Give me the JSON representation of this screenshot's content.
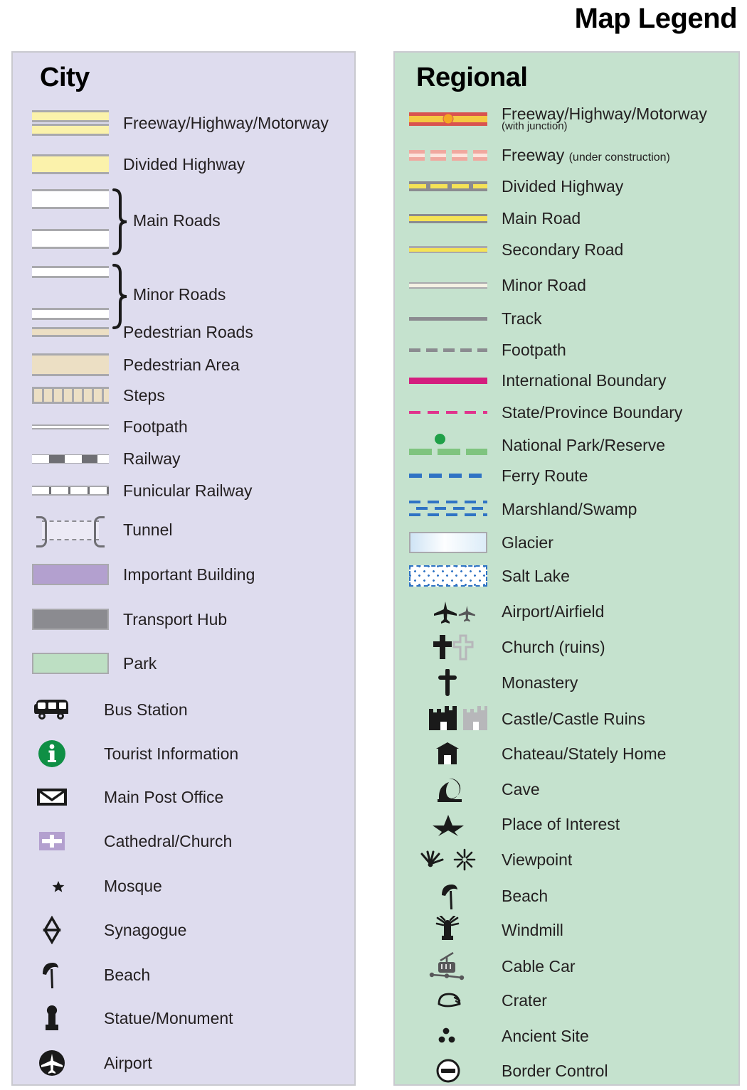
{
  "title": "Map Legend",
  "city": {
    "heading": "City",
    "bg_color": "#dedcee",
    "items": [
      {
        "symbol": "freeway-double-band",
        "label": "Freeway/Highway/Motorway"
      },
      {
        "symbol": "divided-highway-band",
        "label": "Divided Highway"
      },
      {
        "symbol": "main-roads-braced-pair",
        "label": "Main Roads"
      },
      {
        "symbol": "minor-roads-braced-pair",
        "label": "Minor Roads"
      },
      {
        "symbol": "pedestrian-road-band",
        "label": "Pedestrian Roads"
      },
      {
        "symbol": "pedestrian-area-block",
        "label": "Pedestrian Area"
      },
      {
        "symbol": "steps-hatched-band",
        "label": "Steps"
      },
      {
        "symbol": "footpath-thin-line",
        "label": "Footpath"
      },
      {
        "symbol": "railway-dashed-band",
        "label": "Railway"
      },
      {
        "symbol": "funicular-ticked-line",
        "label": "Funicular Railway"
      },
      {
        "symbol": "tunnel-bracketed-dashes",
        "label": "Tunnel"
      },
      {
        "symbol": "important-building-swatch",
        "label": "Important Building"
      },
      {
        "symbol": "transport-hub-swatch",
        "label": "Transport Hub"
      },
      {
        "symbol": "park-swatch",
        "label": "Park"
      },
      {
        "symbol": "bus-icon",
        "label": "Bus Station"
      },
      {
        "symbol": "information-circle-icon",
        "label": "Tourist Information"
      },
      {
        "symbol": "envelope-icon",
        "label": "Main Post Office"
      },
      {
        "symbol": "church-cross-block-icon",
        "label": "Cathedral/Church"
      },
      {
        "symbol": "crescent-star-icon",
        "label": "Mosque"
      },
      {
        "symbol": "star-of-david-icon",
        "label": "Synagogue"
      },
      {
        "symbol": "beach-umbrella-icon",
        "label": "Beach"
      },
      {
        "symbol": "statue-monument-icon",
        "label": "Statue/Monument"
      },
      {
        "symbol": "airport-circle-icon",
        "label": "Airport"
      }
    ]
  },
  "regional": {
    "heading": "Regional",
    "bg_color": "#c5e2ce",
    "items": [
      {
        "symbol": "freeway-junction-line",
        "label": "Freeway/Highway/Motorway",
        "sub": "(with junction)"
      },
      {
        "symbol": "freeway-under-construction-line",
        "label": "Freeway",
        "sub": "(under construction)"
      },
      {
        "symbol": "divided-highway-line",
        "label": "Divided Highway"
      },
      {
        "symbol": "main-road-line",
        "label": "Main Road"
      },
      {
        "symbol": "secondary-road-line",
        "label": "Secondary Road"
      },
      {
        "symbol": "minor-road-line",
        "label": "Minor Road"
      },
      {
        "symbol": "track-line",
        "label": "Track"
      },
      {
        "symbol": "footpath-dashed-line",
        "label": "Footpath"
      },
      {
        "symbol": "international-boundary-line",
        "label": "International Boundary"
      },
      {
        "symbol": "state-province-boundary-line",
        "label": "State/Province Boundary"
      },
      {
        "symbol": "national-park-line",
        "label": "National Park/Reserve"
      },
      {
        "symbol": "ferry-route-line",
        "label": "Ferry Route"
      },
      {
        "symbol": "marshland-swamp-pattern",
        "label": "Marshland/Swamp"
      },
      {
        "symbol": "glacier-swatch",
        "label": "Glacier"
      },
      {
        "symbol": "salt-lake-swatch",
        "label": "Salt Lake"
      },
      {
        "symbol": "airplane-icons",
        "label": "Airport/Airfield"
      },
      {
        "symbol": "cross-icons",
        "label": "Church (ruins)"
      },
      {
        "symbol": "monastery-cross-icon",
        "label": "Monastery"
      },
      {
        "symbol": "castle-icons",
        "label": "Castle/Castle Ruins"
      },
      {
        "symbol": "chateau-icon",
        "label": "Chateau/Stately Home"
      },
      {
        "symbol": "cave-icon",
        "label": "Cave"
      },
      {
        "symbol": "star-icon",
        "label": "Place of Interest"
      },
      {
        "symbol": "viewpoint-icons",
        "label": "Viewpoint"
      },
      {
        "symbol": "beach-umbrella-icon",
        "label": "Beach"
      },
      {
        "symbol": "windmill-icon",
        "label": "Windmill"
      },
      {
        "symbol": "cable-car-icon",
        "label": "Cable Car"
      },
      {
        "symbol": "crater-icon",
        "label": "Crater"
      },
      {
        "symbol": "ancient-site-icon",
        "label": "Ancient Site"
      },
      {
        "symbol": "border-control-icon",
        "label": "Border Control"
      }
    ]
  }
}
